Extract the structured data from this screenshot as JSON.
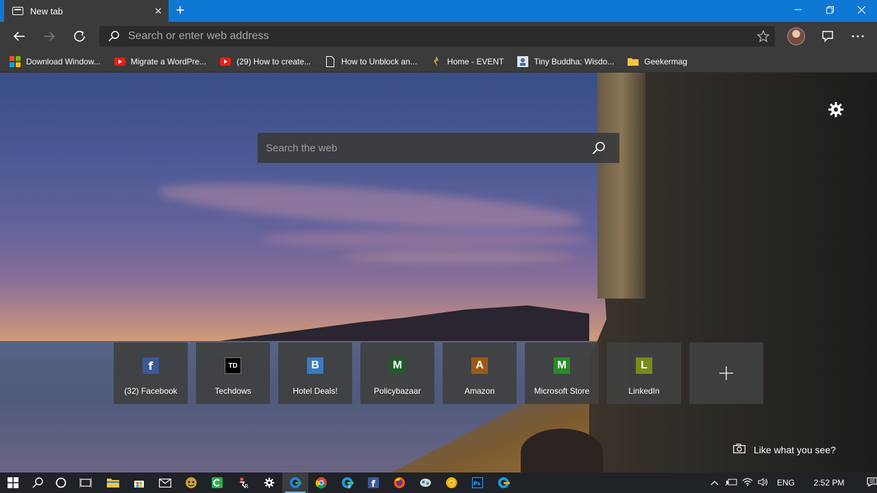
{
  "browser": {
    "tab_title": "New tab",
    "address_placeholder": "Search or enter web address"
  },
  "favorites": [
    {
      "label": "Download Window...",
      "icon": "windows-logo-icon"
    },
    {
      "label": "Migrate a WordPre...",
      "icon": "youtube-icon"
    },
    {
      "label": "(29) How to create...",
      "icon": "youtube-icon"
    },
    {
      "label": "How to Unblock an...",
      "icon": "page-icon"
    },
    {
      "label": "Home - EVENT",
      "icon": "event-icon"
    },
    {
      "label": "Tiny Buddha: Wisdo...",
      "icon": "tinybuddha-icon"
    },
    {
      "label": "Geekermag",
      "icon": "folder-icon"
    }
  ],
  "newtab": {
    "search_placeholder": "Search the web",
    "like_text": "Like what you see?",
    "top_sites": [
      {
        "label": "(32) Facebook",
        "letter": "f",
        "color": "#3b5998"
      },
      {
        "label": "Techdows",
        "letter": "TD",
        "color": "#000000"
      },
      {
        "label": "Hotel Deals!",
        "letter": "B",
        "color": "#3a7bbf"
      },
      {
        "label": "Policybazaar",
        "letter": "M",
        "color": "#1f5c2a"
      },
      {
        "label": "Amazon",
        "letter": "A",
        "color": "#9c5a17"
      },
      {
        "label": "Microsoft Store",
        "letter": "M",
        "color": "#2a8a2a"
      },
      {
        "label": "LinkedIn",
        "letter": "L",
        "color": "#7a8a1a"
      }
    ]
  },
  "taskbar": {
    "language": "ENG",
    "time": "2:52 PM"
  },
  "colors": {
    "titlebar": "#0f78d4",
    "chrome": "#3b3b3b",
    "taskbar": "#1f2226"
  }
}
